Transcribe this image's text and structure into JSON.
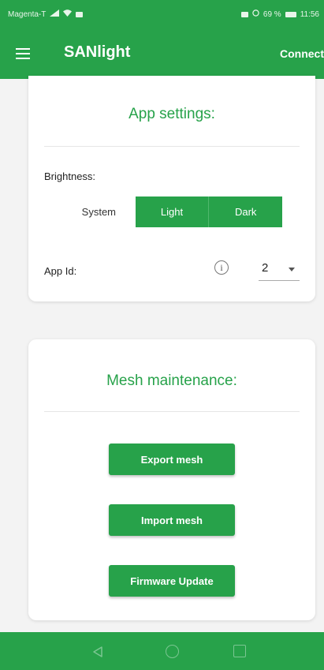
{
  "colors": {
    "primary": "#27a24a",
    "text": "#222222"
  },
  "status_bar": {
    "carrier": "Magenta-T",
    "battery": "69 %",
    "time": "11:56"
  },
  "app_bar": {
    "title": "SANlight",
    "action": "Connect",
    "menu_icon": "hamburger-menu-icon"
  },
  "app_settings": {
    "title": "App settings:",
    "brightness_label": "Brightness:",
    "brightness_options": [
      {
        "label": "System",
        "selected": false
      },
      {
        "label": "Light",
        "selected": true
      },
      {
        "label": "Dark",
        "selected": true
      }
    ],
    "app_id_label": "App Id:",
    "info_icon": "info-icon",
    "app_id_value": "2"
  },
  "mesh_maintenance": {
    "title": "Mesh maintenance:",
    "buttons": {
      "export": "Export mesh",
      "import": "Import mesh",
      "firmware": "Firmware Update"
    }
  },
  "nav_bar": {
    "back_icon": "back-triangle-icon",
    "home_icon": "home-circle-icon",
    "recent_icon": "recent-apps-square-icon"
  }
}
